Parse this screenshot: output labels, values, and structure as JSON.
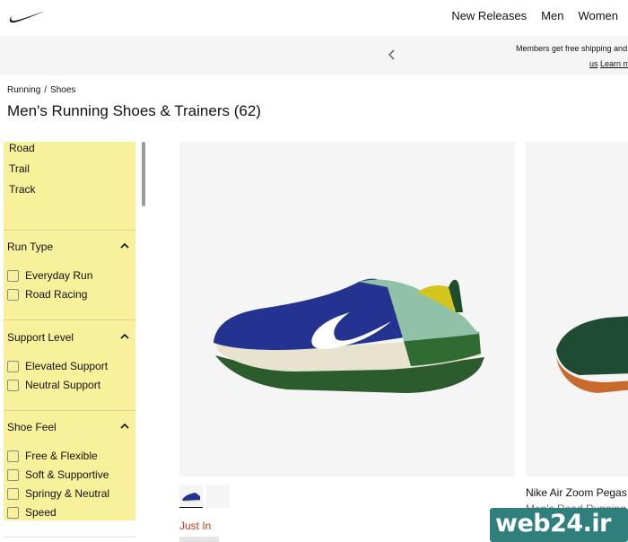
{
  "nav": {
    "logo_icon": "nike-swoosh-icon",
    "links": [
      "New Releases",
      "Men",
      "Women"
    ]
  },
  "banner": {
    "message_line1": "Members get free shipping and",
    "message_line2_prefix": "us",
    "message_line2_link": "Learn m"
  },
  "breadcrumb": {
    "items": [
      "Running",
      "Shoes"
    ],
    "separator": "/"
  },
  "page": {
    "title": "Men's Running Shoes & Trainers (62)"
  },
  "filters": {
    "surface_links": [
      "Road",
      "Trail",
      "Track"
    ],
    "sections": [
      {
        "title": "Run Type",
        "options": [
          "Everyday Run",
          "Road Racing"
        ]
      },
      {
        "title": "Support Level",
        "options": [
          "Elevated Support",
          "Neutral Support"
        ]
      },
      {
        "title": "Shoe Feel",
        "options": [
          "Free & Flexible",
          "Soft & Supportive",
          "Springy & Neutral",
          "Speed"
        ]
      }
    ],
    "highlight_color": "#f8f19b"
  },
  "products": [
    {
      "badge": "Just In",
      "badge_color": "#d33918"
    },
    {
      "title": "Nike Air Zoom Pegas",
      "subtitle": "Men's Road Running"
    }
  ],
  "watermark": {
    "text": "web24.ir"
  }
}
